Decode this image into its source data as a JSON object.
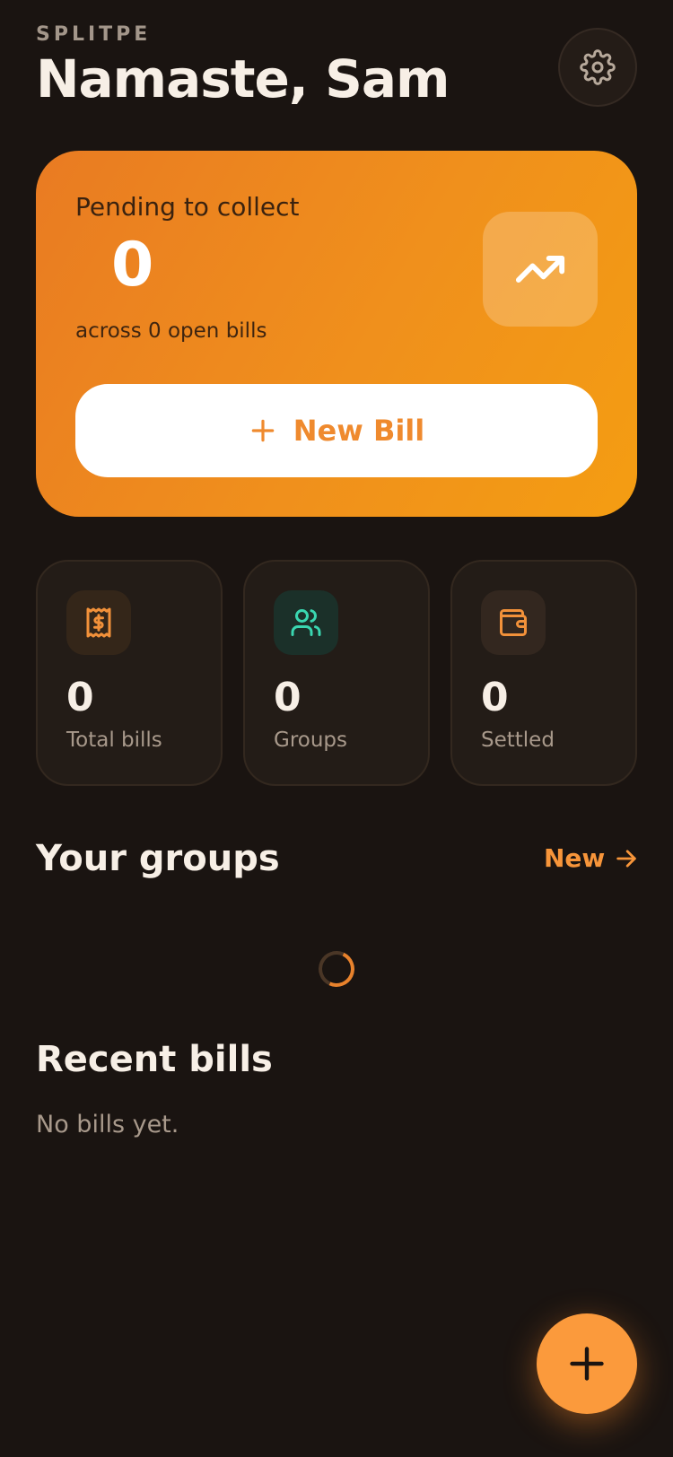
{
  "header": {
    "brand": "SPLITPE",
    "greeting": "Namaste, Sam"
  },
  "hero": {
    "label": "Pending to collect",
    "amount": "0",
    "subtitle": "across 0 open bills",
    "new_bill_label": "New Bill"
  },
  "stats": [
    {
      "value": "0",
      "label": "Total bills",
      "icon": "receipt-icon"
    },
    {
      "value": "0",
      "label": "Groups",
      "icon": "users-icon"
    },
    {
      "value": "0",
      "label": "Settled",
      "icon": "wallet-icon"
    }
  ],
  "groups": {
    "title": "Your groups",
    "new_label": "New"
  },
  "recent_bills": {
    "title": "Recent bills",
    "empty_text": "No bills yet."
  },
  "colors": {
    "background": "#1a1411",
    "accent": "#f7953a",
    "hero_gradient_start": "#e97b22",
    "hero_gradient_end": "#f49d12",
    "teal": "#3ad6b0"
  }
}
